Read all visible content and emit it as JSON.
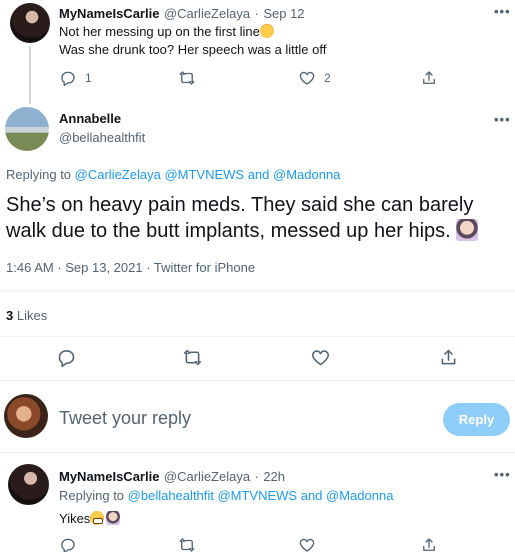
{
  "tweet1": {
    "name": "MyNameIsCarlie",
    "handle": "@CarlieZelaya",
    "sep": "·",
    "date": "Sep 12",
    "line1": "Not her messing up on the first line",
    "line2": "Was she drunk too? Her speech was a little off",
    "replies": "1",
    "likes": "2",
    "more": "•••"
  },
  "main": {
    "name": "Annabelle",
    "handle": "@bellahealthfit",
    "replying_prefix": "Replying to ",
    "replying_to": "@CarlieZelaya @MTVNEWS",
    "replying_and": " and ",
    "replying_last": "@Madonna",
    "text": "She’s on heavy pain meds. They said she can barely walk due to the butt implants, messed up her hips.",
    "timestamp": "1:46 AM · Sep 13, 2021 · Twitter for iPhone",
    "likes_count": "3",
    "likes_label": "Likes",
    "more": "•••"
  },
  "compose": {
    "placeholder": "Tweet your reply",
    "button": "Reply"
  },
  "tweet2": {
    "name": "MyNameIsCarlie",
    "handle": "@CarlieZelaya",
    "sep": "·",
    "date": "22h",
    "replying_prefix": "Replying to ",
    "replying_to": "@bellahealthfit @MTVNEWS",
    "replying_and": " and ",
    "replying_last": "@Madonna",
    "text": "Yikes",
    "more": "•••"
  },
  "icons": {
    "reply": "reply-icon",
    "retweet": "retweet-icon",
    "like": "heart-icon",
    "share": "share-icon"
  },
  "colors": {
    "accent": "#1d9bf0",
    "muted": "#536471",
    "reply_button": "#8ecdf8"
  }
}
